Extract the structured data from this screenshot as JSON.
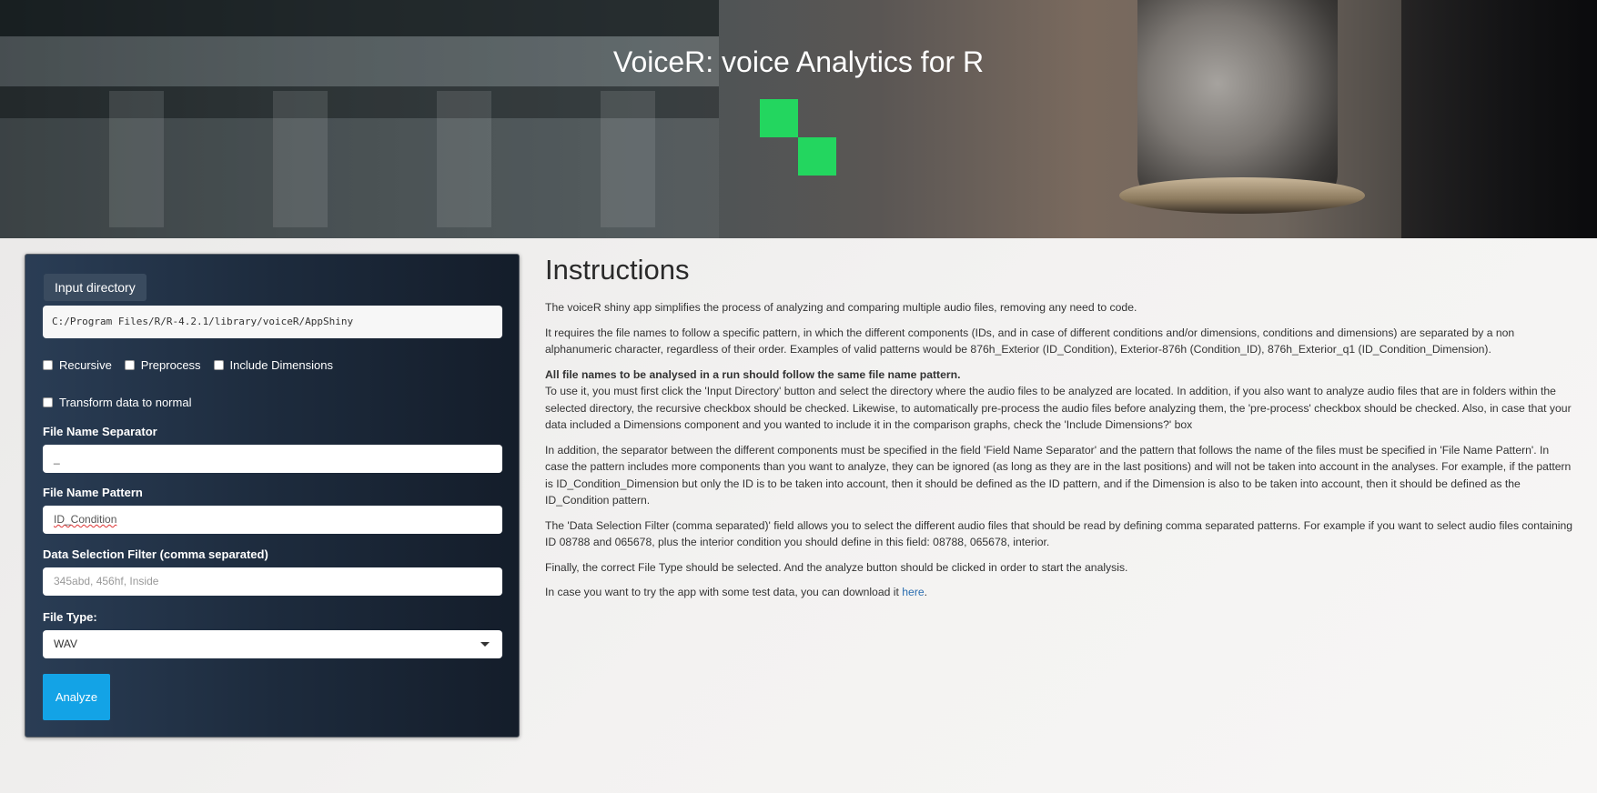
{
  "header": {
    "title": "VoiceR: voice Analytics for R",
    "logo_color": "#23d65f"
  },
  "sidebar": {
    "input_directory_label": "Input directory",
    "directory_path": "C:/Program Files/R/R-4.2.1/library/voiceR/AppShiny",
    "checkboxes": [
      {
        "label": "Recursive",
        "checked": false
      },
      {
        "label": "Preprocess",
        "checked": false
      },
      {
        "label": "Include Dimensions",
        "checked": false
      }
    ],
    "transform_checkbox": {
      "label": "Transform data to normal",
      "checked": false
    },
    "separator": {
      "label": "File Name Separator",
      "value": "_"
    },
    "pattern": {
      "label": "File Name Pattern",
      "value": "ID_Condition"
    },
    "filter": {
      "label": "Data Selection Filter (comma separated)",
      "placeholder": "345abd, 456hf, Inside"
    },
    "file_type": {
      "label": "File Type:",
      "value": "WAV"
    },
    "analyze_label": "Analyze",
    "analyze_color": "#13a3e6"
  },
  "instructions": {
    "heading": "Instructions",
    "p1": "The voiceR shiny app simplifies the process of analyzing and comparing multiple audio files, removing any need to code.",
    "p2": "It requires the file names to follow a specific pattern, in which the different components (IDs, and in case of different conditions and/or dimensions, conditions and dimensions) are separated by a non alphanumeric character, regardless of their order. Examples of valid patterns would be 876h_Exterior (ID_Condition), Exterior-876h (Condition_ID), 876h_Exterior_q1 (ID_Condition_Dimension).",
    "p3_bold": "All file names to be analysed in a run should follow the same file name pattern.",
    "p3": "To use it, you must first click the 'Input Directory' button and select the directory where the audio files to be analyzed are located. In addition, if you also want to analyze audio files that are in folders within the selected directory, the recursive checkbox should be checked. Likewise, to automatically pre-process the audio files before analyzing them, the 'pre-process' checkbox should be checked. Also, in case that your data included a Dimensions component and you wanted to include it in the comparison graphs, check the 'Include Dimensions?' box",
    "p4": "In addition, the separator between the different components must be specified in the field 'Field Name Separator' and the pattern that follows the name of the files must be specified in 'File Name Pattern'. In case the pattern includes more components than you want to analyze, they can be ignored (as long as they are in the last positions) and will not be taken into account in the analyses. For example, if the pattern is ID_Condition_Dimension but only the ID is to be taken into account, then it should be defined as the ID pattern, and if the Dimension is also to be taken into account, then it should be defined as the ID_Condition pattern.",
    "p5": "The 'Data Selection Filter (comma separated)' field allows you to select the different audio files that should be read by defining comma separated patterns. For example if you want to select audio files containing ID 08788 and 065678, plus the interior condition you should define in this field: 08788, 065678, interior.",
    "p6": "Finally, the correct File Type should be selected. And the analyze button should be clicked in order to start the analysis.",
    "p7_prefix": "In case you want to try the app with some test data, you can download it ",
    "p7_link": "here",
    "p7_suffix": "."
  }
}
